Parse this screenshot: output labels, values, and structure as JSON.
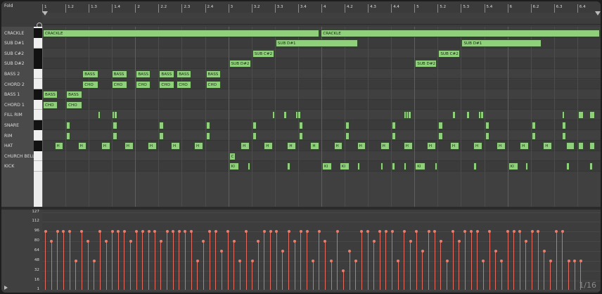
{
  "header": {
    "fold_label": "Fold"
  },
  "ruler": {
    "labels": [
      "1",
      "1.2",
      "1.3",
      "1.4",
      "2",
      "2.2",
      "2.3",
      "2.4",
      "3",
      "3.2",
      "3.3",
      "3.4",
      "4",
      "4.2",
      "4.3",
      "4.4",
      "5",
      "5.2",
      "5.3",
      "5.4",
      "6",
      "6.2",
      "6.3",
      "6.4"
    ]
  },
  "lanes": [
    "CRACKLE",
    "SUB D#1",
    "SUB C#2",
    "SUB D#2",
    "BASS 2",
    "CHORD 2",
    "BASS 1",
    "CHORD 1",
    "FILL RIM",
    "SNARE",
    "RIM",
    "HAT",
    "CHURCH BELL",
    "KICK"
  ],
  "velocity": {
    "scale": [
      "127",
      "112",
      "96",
      "80",
      "64",
      "48",
      "32",
      "16",
      "1"
    ],
    "quantize_label": "1/16",
    "values": [
      96,
      80,
      96,
      96,
      96,
      48,
      96,
      80,
      48,
      96,
      80,
      96,
      96,
      96,
      80,
      96,
      96,
      96,
      96,
      80,
      96,
      96,
      96,
      96,
      96,
      48,
      80,
      96,
      96,
      64,
      96,
      80,
      48,
      96,
      48,
      80,
      96,
      96,
      96,
      64,
      96,
      80,
      96,
      96,
      48,
      96,
      80,
      48,
      96,
      32,
      64,
      48,
      96,
      96,
      80,
      96,
      96,
      96,
      48,
      96,
      80,
      96,
      64,
      96,
      96,
      80,
      48,
      96,
      80,
      96,
      96,
      96,
      48,
      96,
      64,
      48,
      96,
      96,
      96,
      80,
      96,
      96,
      64,
      48,
      96,
      96,
      48,
      48,
      48
    ]
  }
}
